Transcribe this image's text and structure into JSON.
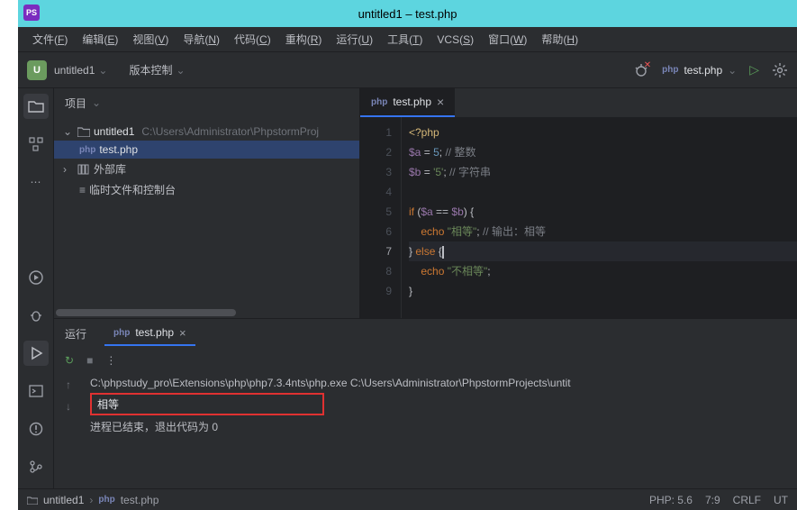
{
  "window": {
    "title": "untitled1 – test.php"
  },
  "menubar": [
    {
      "l": "文件",
      "k": "F"
    },
    {
      "l": "编辑",
      "k": "E"
    },
    {
      "l": "视图",
      "k": "V"
    },
    {
      "l": "导航",
      "k": "N"
    },
    {
      "l": "代码",
      "k": "C"
    },
    {
      "l": "重构",
      "k": "R"
    },
    {
      "l": "运行",
      "k": "U"
    },
    {
      "l": "工具",
      "k": "T"
    },
    {
      "l": "VCS",
      "k": "S"
    },
    {
      "l": "窗口",
      "k": "W"
    },
    {
      "l": "帮助",
      "k": "H"
    }
  ],
  "toolbar": {
    "project": "untitled1",
    "vcs": "版本控制",
    "runConfig": "test.php"
  },
  "project": {
    "title": "项目",
    "root": {
      "name": "untitled1",
      "path": "C:\\Users\\Administrator\\PhpstormProj"
    },
    "file": "test.php",
    "libs": "外部库",
    "scratch": "临时文件和控制台"
  },
  "editor": {
    "tab": "test.php",
    "lines": [
      {
        "n": 1,
        "html": "<span class='k-tag'>&lt;?php</span>"
      },
      {
        "n": 2,
        "html": "<span class='k-var'>$a</span> <span class='k-op'>=</span> <span class='k-num'>5</span><span class='k-op'>;</span> <span class='k-cmt'>// 整数</span>"
      },
      {
        "n": 3,
        "html": "<span class='k-var'>$b</span> <span class='k-op'>=</span> <span class='k-str'>'5'</span><span class='k-op'>;</span> <span class='k-cmt'>// 字符串</span>"
      },
      {
        "n": 4,
        "html": ""
      },
      {
        "n": 5,
        "html": "<span class='k-kw'>if</span> <span class='k-op'>(</span><span class='k-var'>$a</span> <span class='k-op'>==</span> <span class='k-var'>$b</span><span class='k-op'>) {</span>"
      },
      {
        "n": 6,
        "html": "    <span class='k-kw'>echo</span> <span class='k-str'>\"相等\"</span><span class='k-op'>;</span> <span class='k-cmt'>// 输出：相等</span>"
      },
      {
        "n": 7,
        "cur": true,
        "html": "<span class='k-op'>}</span> <span class='k-kw'>else</span> <span class='k-op'>{</span><span class='caret'></span>"
      },
      {
        "n": 8,
        "html": "    <span class='k-kw'>echo</span> <span class='k-str'>\"不相等\"</span><span class='k-op'>;</span>"
      },
      {
        "n": 9,
        "html": "<span class='k-op'>}</span>"
      }
    ]
  },
  "run": {
    "title": "运行",
    "tab": "test.php",
    "cmd": "C:\\phpstudy_pro\\Extensions\\php\\php7.3.4nts\\php.exe C:\\Users\\Administrator\\PhpstormProjects\\untit",
    "output": "相等",
    "exit": "进程已结束，退出代码为 0"
  },
  "status": {
    "bc_proj": "untitled1",
    "bc_file": "test.php",
    "php": "PHP: 5.6",
    "pos": "7:9",
    "crlf": "CRLF",
    "enc": "UT"
  }
}
